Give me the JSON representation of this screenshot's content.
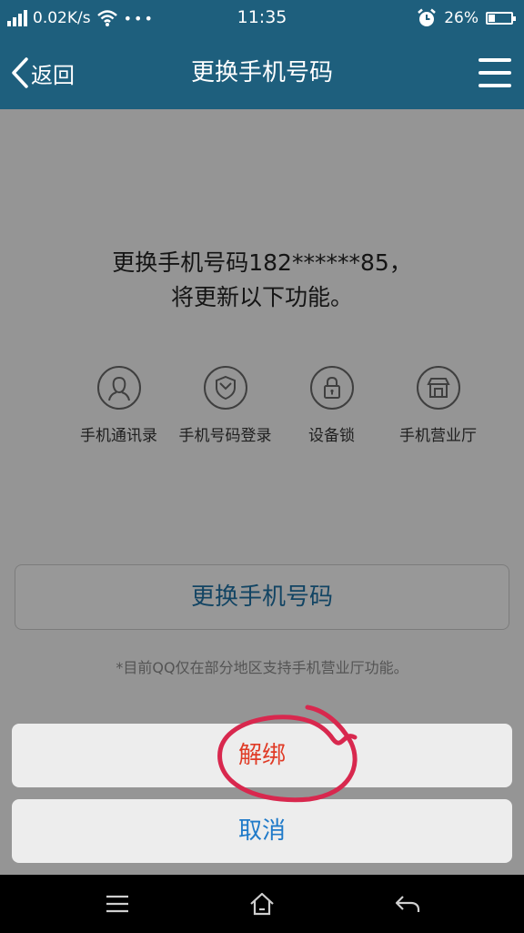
{
  "status_bar": {
    "network_speed": "0.02K/s",
    "more": "•••",
    "time": "11:35",
    "battery": "26%"
  },
  "header": {
    "back_label": "返回",
    "title": "更换手机号码",
    "menu_icon": "hamburger-menu-icon",
    "background_color": "#1e5f7d"
  },
  "main": {
    "notice_line1": "更换手机号码182******85，",
    "notice_line2": "将更新以下功能。",
    "features": [
      {
        "label": "手机通讯录",
        "icon": "contacts-icon"
      },
      {
        "label": "手机号码登录",
        "icon": "shield-icon"
      },
      {
        "label": "设备锁",
        "icon": "lock-icon"
      },
      {
        "label": "手机营业厅",
        "icon": "store-icon"
      }
    ],
    "change_button": "更换手机号码",
    "footnote": "*目前QQ仅在部分地区支持手机营业厅功能。"
  },
  "action_sheet": {
    "unbind_label": "解绑",
    "cancel_label": "取消",
    "unbind_color": "#e03b26",
    "cancel_color": "#1f7ac9",
    "annotation_color": "#d8284e"
  },
  "nav_bar": {
    "items": [
      {
        "icon": "menu-icon"
      },
      {
        "icon": "home-icon"
      },
      {
        "icon": "back-arrow-icon"
      }
    ]
  }
}
